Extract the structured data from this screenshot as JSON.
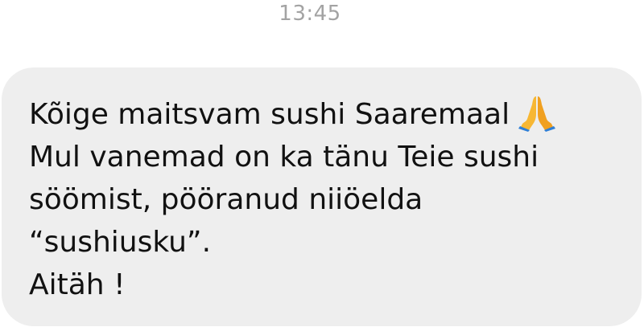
{
  "timestamp": "13:45",
  "message": {
    "lines": [
      "Kõige maitsvam sushi Saaremaal",
      "Mul vanemad on ka tänu Teie sushi",
      "söömist, pööranud niiöelda",
      "“sushiusku”.",
      "Aitäh !"
    ],
    "emoji_icon": "folded-hands-emoji"
  },
  "colors": {
    "bubble_background": "#eeeeee",
    "text": "#111111",
    "timestamp": "#a3a3a3"
  }
}
